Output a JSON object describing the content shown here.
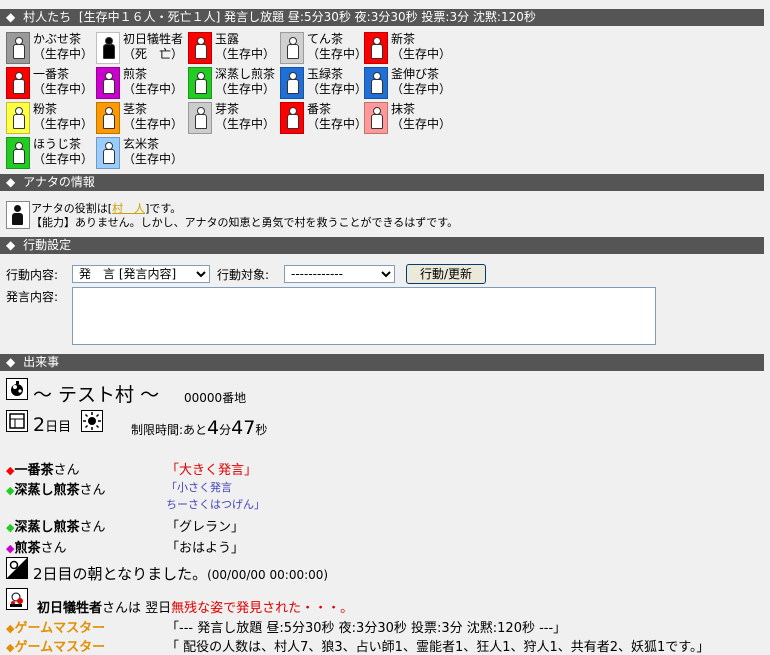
{
  "villagers_header": {
    "diamond": "◆",
    "title": "村人たち",
    "info": "[生存中１６人・死亡１人] 発言し放題 昼:5分30秒 夜:3分30秒 投票:3分 沈黙:120秒"
  },
  "villagers": [
    {
      "name": "かぶせ茶",
      "status": "（生存中）",
      "color": "#9a9a9a",
      "dead": false
    },
    {
      "name": "初日犠牲者",
      "status": "（死　亡）",
      "color": "#ffffff",
      "dead": true
    },
    {
      "name": "玉露",
      "status": "（生存中）",
      "color": "#ff0000",
      "dead": false
    },
    {
      "name": "てん茶",
      "status": "（生存中）",
      "color": "#d0d0d0",
      "dead": false
    },
    {
      "name": "新茶",
      "status": "（生存中）",
      "color": "#ff0000",
      "dead": false
    },
    {
      "name": "一番茶",
      "status": "（生存中）",
      "color": "#ff0000",
      "dead": false
    },
    {
      "name": "煎茶",
      "status": "（生存中）",
      "color": "#cc00cc",
      "dead": false
    },
    {
      "name": "深蒸し煎茶",
      "status": "（生存中）",
      "color": "#22cc22",
      "dead": false
    },
    {
      "name": "玉緑茶",
      "status": "（生存中）",
      "color": "#1f6fd6",
      "dead": false
    },
    {
      "name": "釜伸び茶",
      "status": "（生存中）",
      "color": "#1f6fd6",
      "dead": false
    },
    {
      "name": "粉茶",
      "status": "（生存中）",
      "color": "#ffff44",
      "dead": false
    },
    {
      "name": "茎茶",
      "status": "（生存中）",
      "color": "#ff9900",
      "dead": false
    },
    {
      "name": "芽茶",
      "status": "（生存中）",
      "color": "#cccccc",
      "dead": false
    },
    {
      "name": "番茶",
      "status": "（生存中）",
      "color": "#ff0000",
      "dead": false
    },
    {
      "name": "抹茶",
      "status": "（生存中）",
      "color": "#ff9999",
      "dead": false
    },
    {
      "name": "ほうじ茶",
      "status": "（生存中）",
      "color": "#22cc22",
      "dead": false
    },
    {
      "name": "玄米茶",
      "status": "（生存中）",
      "color": "#99ccff",
      "dead": false
    }
  ],
  "info_header": {
    "diamond": "◆",
    "title": "アナタの情報"
  },
  "role": {
    "prefix": "アナタの役割は[",
    "role_name": "村　人",
    "suffix": "]です。",
    "ability": "【能力】ありません。しかし、アナタの知恵と勇気で村を救うことができるはずです。"
  },
  "action_header": {
    "diamond": "◆",
    "title": "行動設定"
  },
  "action": {
    "content_label": "行動内容:",
    "content_value": "発　言 [発言内容]",
    "target_label": "行動対象:",
    "target_value": "------------",
    "submit": "行動/更新",
    "speech_label": "発言内容:"
  },
  "events_header": {
    "diamond": "◆",
    "title": "出来事"
  },
  "village": {
    "title": "～ テスト村 ～",
    "address": "00000番地",
    "day_num": "2",
    "day_unit": "日目",
    "limit_label": "制限時間:あと",
    "min": "4",
    "min_unit": "分",
    "sec": "47",
    "sec_unit": "秒"
  },
  "chat": [
    {
      "marker": "◆",
      "marker_color": "#ff0000",
      "speaker": "一番茶",
      "suffix": "さん",
      "lines": [
        "「大きく発言」"
      ]
    },
    {
      "marker": "◆",
      "marker_color": "#22cc22",
      "speaker": "深蒸し煎茶",
      "suffix": "さん",
      "lines": [
        "「小さく発言",
        "ちーさくはつげん」"
      ]
    },
    {
      "marker": "◆",
      "marker_color": "#22cc22",
      "speaker": "深蒸し煎茶",
      "suffix": "さん",
      "lines": [
        "「グレラン」"
      ]
    },
    {
      "marker": "◆",
      "marker_color": "#cc00cc",
      "speaker": "煎茶",
      "suffix": "さん",
      "lines": [
        "「おはよう」"
      ]
    }
  ],
  "morning": {
    "text": "2日目の朝となりました。",
    "time": "(00/00/00 00:00:00)"
  },
  "victim": {
    "name": "初日犠牲者",
    "suffix": "さんは 翌日",
    "found": "無残な姿で発見された・・・。"
  },
  "gm": [
    {
      "marker": "◆",
      "name": "ゲームマスター",
      "text": "「--- 発言し放題 昼:5分30秒 夜:3分30秒 投票:3分 沈黙:120秒 ---」"
    },
    {
      "marker": "◆",
      "name": "ゲームマスター",
      "text": "「 配役の人数は、村人7、狼3、占い師1、霊能者1、狂人1、狩人1、共有者2、妖狐1です。」"
    }
  ]
}
